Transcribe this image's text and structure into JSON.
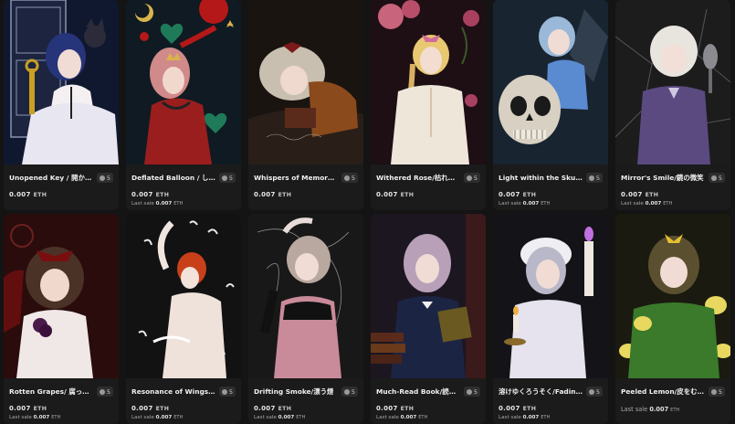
{
  "currency_unit": "ETH",
  "last_sale_label": "Last sale",
  "cards": [
    {
      "title": "Unopened Key / 開かずの鍵",
      "editions": "5",
      "price": "0.007",
      "last_sale": ""
    },
    {
      "title": "Deflated Balloon / しぼん…",
      "editions": "5",
      "price": "0.007",
      "last_sale": "0.007"
    },
    {
      "title": "Whispers of Memory / 心…",
      "editions": "5",
      "price": "0.007",
      "last_sale": ""
    },
    {
      "title": "Withered Rose/枯れた薔薇",
      "editions": "5",
      "price": "0.007",
      "last_sale": ""
    },
    {
      "title": "Light within the Skull/骸骨…",
      "editions": "5",
      "price": "0.007",
      "last_sale": "0.007"
    },
    {
      "title": "Mirror's Smile/鏡の微笑",
      "editions": "5",
      "price": "0.007",
      "last_sale": "0.007"
    },
    {
      "title": "Rotten Grapes/ 腐ったぶ…",
      "editions": "5",
      "price": "0.007",
      "last_sale": "0.007"
    },
    {
      "title": "Resonance of Wings/羽の…",
      "editions": "5",
      "price": "0.007",
      "last_sale": "0.007"
    },
    {
      "title": "Drifting Smoke/漂う煙",
      "editions": "5",
      "price": "0.007",
      "last_sale": "0.007"
    },
    {
      "title": "Much-Read Book/読み込…",
      "editions": "5",
      "price": "0.007",
      "last_sale": "0.007"
    },
    {
      "title": "溶けゆくろうそく/Fading …",
      "editions": "5",
      "price": "0.007",
      "last_sale": "0.007"
    },
    {
      "title": "Peeled Lemon/皮をむかれ…",
      "editions": "5",
      "price": "",
      "last_sale": "0.007"
    }
  ]
}
